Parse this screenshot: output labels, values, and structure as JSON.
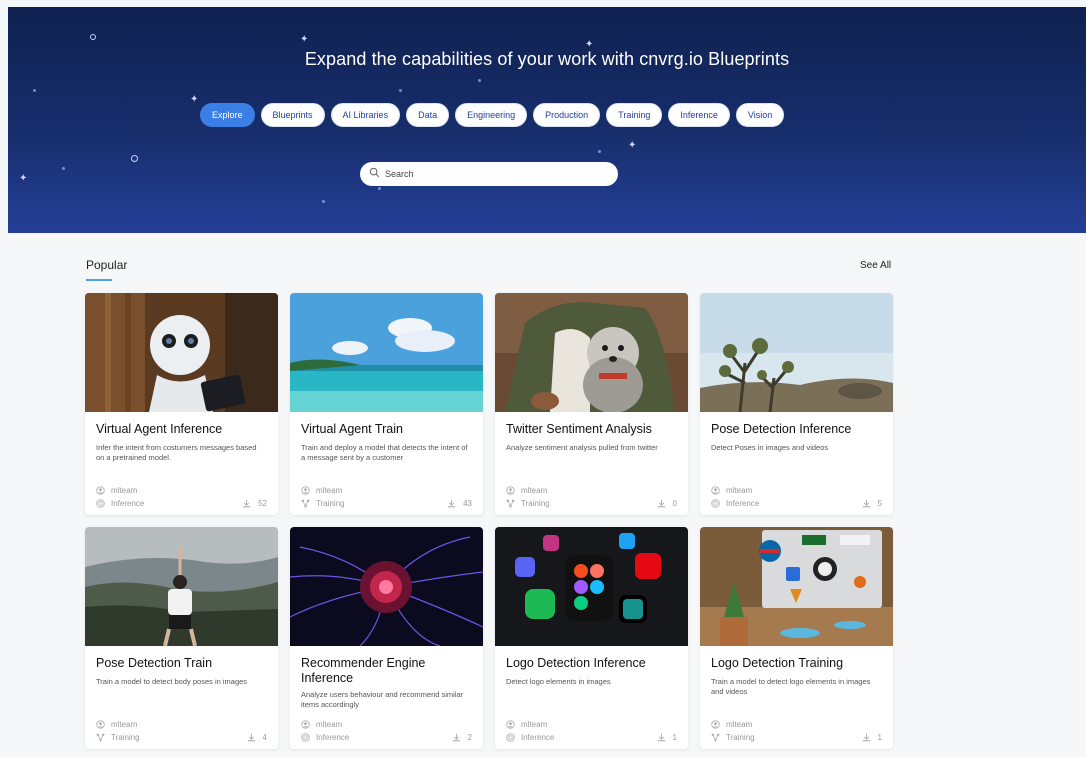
{
  "hero": {
    "title": "Expand the capabilities of your work with cnvrg.io Blueprints",
    "tags": [
      "Explore",
      "Blueprints",
      "AI Libraries",
      "Data",
      "Engineering",
      "Production",
      "Training",
      "Inference",
      "Vision"
    ],
    "active_tag": "Explore",
    "search_placeholder": "Search"
  },
  "popular": {
    "title": "Popular",
    "see_all": "See All"
  },
  "cards": [
    {
      "title": "Virtual Agent Inference",
      "desc": "Infer the intent from costumers messages based on a pretrained model.",
      "author": "mlteam",
      "category": "Inference",
      "downloads": "52",
      "image": "robot"
    },
    {
      "title": "Virtual Agent Train",
      "desc": "Train and deploy a model that detects the intent of a message sent by a customer",
      "author": "mlteam",
      "category": "Training",
      "downloads": "43",
      "image": "beach"
    },
    {
      "title": "Twitter Sentiment Analysis",
      "desc": "Analyze sentiment analysis pulled from twitter",
      "author": "mlteam",
      "category": "Training",
      "downloads": "0",
      "image": "dog"
    },
    {
      "title": "Pose Detection Inference",
      "desc": "Detect Poses in images and videos",
      "author": "mlteam",
      "category": "Inference",
      "downloads": "5",
      "image": "desert"
    },
    {
      "title": "Pose Detection Train",
      "desc": "Train a model to detect body poses in images",
      "author": "mlteam",
      "category": "Training",
      "downloads": "4",
      "image": "yoga"
    },
    {
      "title": "Recommender Engine Inference",
      "desc": "Analyze users behaviour and recommend similar items accordingly",
      "author": "mlteam",
      "category": "Inference",
      "downloads": "2",
      "image": "plasma"
    },
    {
      "title": "Logo Detection Inference",
      "desc": "Detect logo elements in images",
      "author": "mlteam",
      "category": "Inference",
      "downloads": "1",
      "image": "logos"
    },
    {
      "title": "Logo Detection Training",
      "desc": "Train a model to detect logo elements in images and videos",
      "author": "mlteam",
      "category": "Training",
      "downloads": "1",
      "image": "laptop"
    }
  ],
  "icons": {
    "author": "user-icon",
    "inference": "target-icon",
    "training": "network-icon",
    "downloads": "download-icon",
    "search": "search-icon"
  },
  "colors": {
    "hero_dark": "#0f2150",
    "hero_light": "#253f97",
    "accent": "#3b7ee6",
    "tag_text": "#1f3f9a"
  }
}
